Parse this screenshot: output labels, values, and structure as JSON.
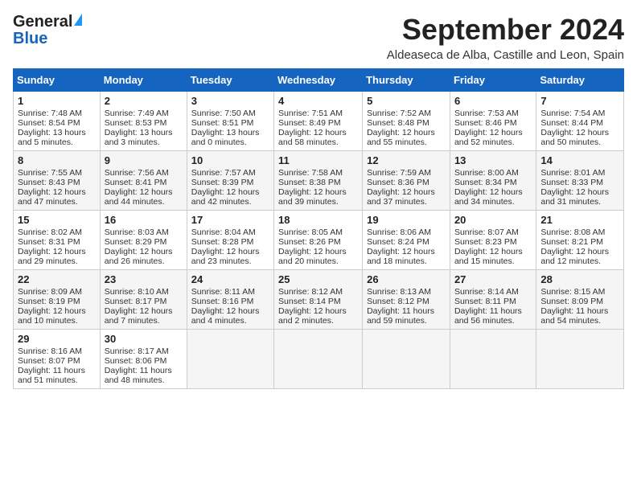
{
  "header": {
    "title": "September 2024",
    "location": "Aldeaseca de Alba, Castille and Leon, Spain",
    "logo_general": "General",
    "logo_blue": "Blue"
  },
  "days_of_week": [
    "Sunday",
    "Monday",
    "Tuesday",
    "Wednesday",
    "Thursday",
    "Friday",
    "Saturday"
  ],
  "weeks": [
    [
      {
        "day": "1",
        "lines": [
          "Sunrise: 7:48 AM",
          "Sunset: 8:54 PM",
          "Daylight: 13 hours",
          "and 5 minutes."
        ]
      },
      {
        "day": "2",
        "lines": [
          "Sunrise: 7:49 AM",
          "Sunset: 8:53 PM",
          "Daylight: 13 hours",
          "and 3 minutes."
        ]
      },
      {
        "day": "3",
        "lines": [
          "Sunrise: 7:50 AM",
          "Sunset: 8:51 PM",
          "Daylight: 13 hours",
          "and 0 minutes."
        ]
      },
      {
        "day": "4",
        "lines": [
          "Sunrise: 7:51 AM",
          "Sunset: 8:49 PM",
          "Daylight: 12 hours",
          "and 58 minutes."
        ]
      },
      {
        "day": "5",
        "lines": [
          "Sunrise: 7:52 AM",
          "Sunset: 8:48 PM",
          "Daylight: 12 hours",
          "and 55 minutes."
        ]
      },
      {
        "day": "6",
        "lines": [
          "Sunrise: 7:53 AM",
          "Sunset: 8:46 PM",
          "Daylight: 12 hours",
          "and 52 minutes."
        ]
      },
      {
        "day": "7",
        "lines": [
          "Sunrise: 7:54 AM",
          "Sunset: 8:44 PM",
          "Daylight: 12 hours",
          "and 50 minutes."
        ]
      }
    ],
    [
      {
        "day": "8",
        "lines": [
          "Sunrise: 7:55 AM",
          "Sunset: 8:43 PM",
          "Daylight: 12 hours",
          "and 47 minutes."
        ]
      },
      {
        "day": "9",
        "lines": [
          "Sunrise: 7:56 AM",
          "Sunset: 8:41 PM",
          "Daylight: 12 hours",
          "and 44 minutes."
        ]
      },
      {
        "day": "10",
        "lines": [
          "Sunrise: 7:57 AM",
          "Sunset: 8:39 PM",
          "Daylight: 12 hours",
          "and 42 minutes."
        ]
      },
      {
        "day": "11",
        "lines": [
          "Sunrise: 7:58 AM",
          "Sunset: 8:38 PM",
          "Daylight: 12 hours",
          "and 39 minutes."
        ]
      },
      {
        "day": "12",
        "lines": [
          "Sunrise: 7:59 AM",
          "Sunset: 8:36 PM",
          "Daylight: 12 hours",
          "and 37 minutes."
        ]
      },
      {
        "day": "13",
        "lines": [
          "Sunrise: 8:00 AM",
          "Sunset: 8:34 PM",
          "Daylight: 12 hours",
          "and 34 minutes."
        ]
      },
      {
        "day": "14",
        "lines": [
          "Sunrise: 8:01 AM",
          "Sunset: 8:33 PM",
          "Daylight: 12 hours",
          "and 31 minutes."
        ]
      }
    ],
    [
      {
        "day": "15",
        "lines": [
          "Sunrise: 8:02 AM",
          "Sunset: 8:31 PM",
          "Daylight: 12 hours",
          "and 29 minutes."
        ]
      },
      {
        "day": "16",
        "lines": [
          "Sunrise: 8:03 AM",
          "Sunset: 8:29 PM",
          "Daylight: 12 hours",
          "and 26 minutes."
        ]
      },
      {
        "day": "17",
        "lines": [
          "Sunrise: 8:04 AM",
          "Sunset: 8:28 PM",
          "Daylight: 12 hours",
          "and 23 minutes."
        ]
      },
      {
        "day": "18",
        "lines": [
          "Sunrise: 8:05 AM",
          "Sunset: 8:26 PM",
          "Daylight: 12 hours",
          "and 20 minutes."
        ]
      },
      {
        "day": "19",
        "lines": [
          "Sunrise: 8:06 AM",
          "Sunset: 8:24 PM",
          "Daylight: 12 hours",
          "and 18 minutes."
        ]
      },
      {
        "day": "20",
        "lines": [
          "Sunrise: 8:07 AM",
          "Sunset: 8:23 PM",
          "Daylight: 12 hours",
          "and 15 minutes."
        ]
      },
      {
        "day": "21",
        "lines": [
          "Sunrise: 8:08 AM",
          "Sunset: 8:21 PM",
          "Daylight: 12 hours",
          "and 12 minutes."
        ]
      }
    ],
    [
      {
        "day": "22",
        "lines": [
          "Sunrise: 8:09 AM",
          "Sunset: 8:19 PM",
          "Daylight: 12 hours",
          "and 10 minutes."
        ]
      },
      {
        "day": "23",
        "lines": [
          "Sunrise: 8:10 AM",
          "Sunset: 8:17 PM",
          "Daylight: 12 hours",
          "and 7 minutes."
        ]
      },
      {
        "day": "24",
        "lines": [
          "Sunrise: 8:11 AM",
          "Sunset: 8:16 PM",
          "Daylight: 12 hours",
          "and 4 minutes."
        ]
      },
      {
        "day": "25",
        "lines": [
          "Sunrise: 8:12 AM",
          "Sunset: 8:14 PM",
          "Daylight: 12 hours",
          "and 2 minutes."
        ]
      },
      {
        "day": "26",
        "lines": [
          "Sunrise: 8:13 AM",
          "Sunset: 8:12 PM",
          "Daylight: 11 hours",
          "and 59 minutes."
        ]
      },
      {
        "day": "27",
        "lines": [
          "Sunrise: 8:14 AM",
          "Sunset: 8:11 PM",
          "Daylight: 11 hours",
          "and 56 minutes."
        ]
      },
      {
        "day": "28",
        "lines": [
          "Sunrise: 8:15 AM",
          "Sunset: 8:09 PM",
          "Daylight: 11 hours",
          "and 54 minutes."
        ]
      }
    ],
    [
      {
        "day": "29",
        "lines": [
          "Sunrise: 8:16 AM",
          "Sunset: 8:07 PM",
          "Daylight: 11 hours",
          "and 51 minutes."
        ]
      },
      {
        "day": "30",
        "lines": [
          "Sunrise: 8:17 AM",
          "Sunset: 8:06 PM",
          "Daylight: 11 hours",
          "and 48 minutes."
        ]
      },
      {
        "day": "",
        "lines": []
      },
      {
        "day": "",
        "lines": []
      },
      {
        "day": "",
        "lines": []
      },
      {
        "day": "",
        "lines": []
      },
      {
        "day": "",
        "lines": []
      }
    ]
  ]
}
